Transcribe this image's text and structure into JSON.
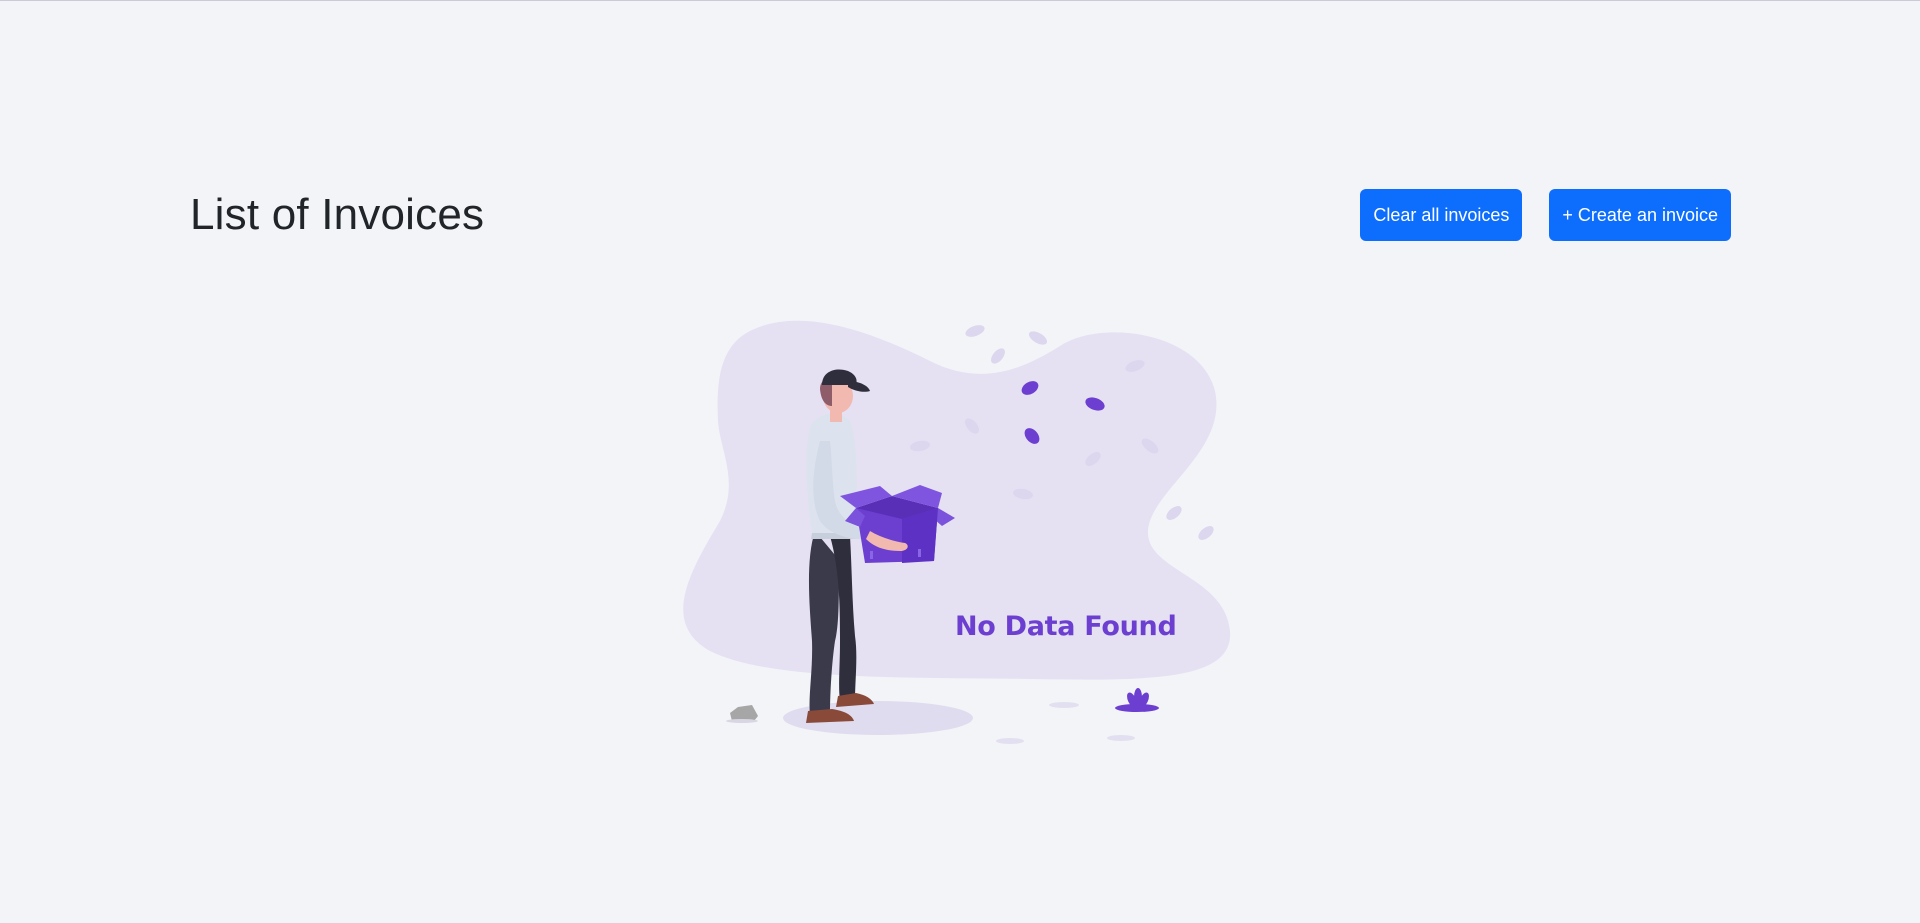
{
  "page": {
    "title": "List of Invoices"
  },
  "toolbar": {
    "clear_label": "Clear all invoices",
    "create_label": "+ Create an invoice"
  },
  "empty_state": {
    "message": "No Data Found"
  },
  "colors": {
    "primary": "#0d6efd",
    "accent": "#6c3fd1",
    "background": "#f3f4f8"
  }
}
